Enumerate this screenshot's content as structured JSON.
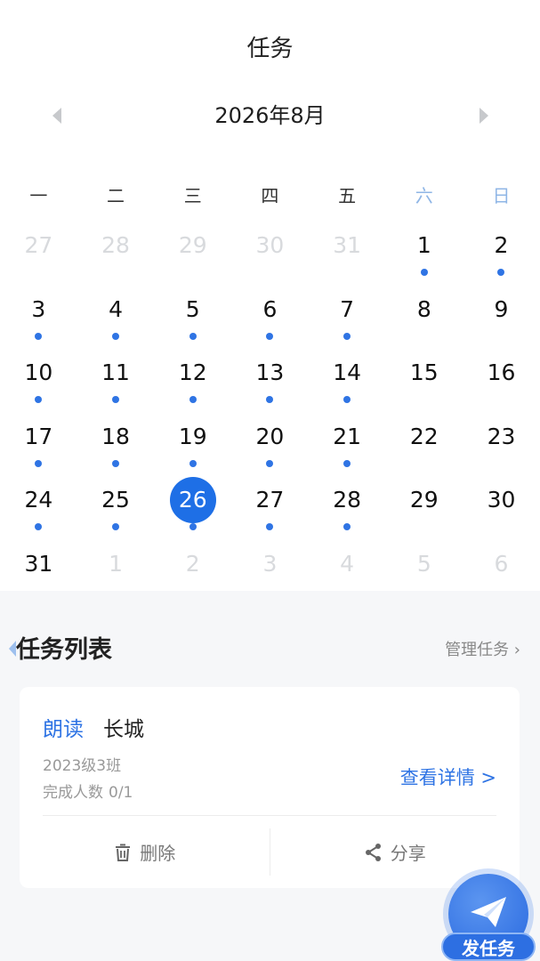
{
  "header": {
    "title": "任务"
  },
  "calendar": {
    "month_label": "2026年8月",
    "weekdays": [
      "一",
      "二",
      "三",
      "四",
      "五",
      "六",
      "日"
    ],
    "weekend_indices": [
      5,
      6
    ],
    "selected_day": 26,
    "days": [
      {
        "n": "27",
        "muted": true,
        "dot": false
      },
      {
        "n": "28",
        "muted": true,
        "dot": false
      },
      {
        "n": "29",
        "muted": true,
        "dot": false
      },
      {
        "n": "30",
        "muted": true,
        "dot": false
      },
      {
        "n": "31",
        "muted": true,
        "dot": false
      },
      {
        "n": "1",
        "muted": false,
        "dot": true
      },
      {
        "n": "2",
        "muted": false,
        "dot": true
      },
      {
        "n": "3",
        "muted": false,
        "dot": true
      },
      {
        "n": "4",
        "muted": false,
        "dot": true
      },
      {
        "n": "5",
        "muted": false,
        "dot": true
      },
      {
        "n": "6",
        "muted": false,
        "dot": true
      },
      {
        "n": "7",
        "muted": false,
        "dot": true
      },
      {
        "n": "8",
        "muted": false,
        "dot": false
      },
      {
        "n": "9",
        "muted": false,
        "dot": false
      },
      {
        "n": "10",
        "muted": false,
        "dot": true
      },
      {
        "n": "11",
        "muted": false,
        "dot": true
      },
      {
        "n": "12",
        "muted": false,
        "dot": true
      },
      {
        "n": "13",
        "muted": false,
        "dot": true
      },
      {
        "n": "14",
        "muted": false,
        "dot": true
      },
      {
        "n": "15",
        "muted": false,
        "dot": false
      },
      {
        "n": "16",
        "muted": false,
        "dot": false
      },
      {
        "n": "17",
        "muted": false,
        "dot": true
      },
      {
        "n": "18",
        "muted": false,
        "dot": true
      },
      {
        "n": "19",
        "muted": false,
        "dot": true
      },
      {
        "n": "20",
        "muted": false,
        "dot": true
      },
      {
        "n": "21",
        "muted": false,
        "dot": true
      },
      {
        "n": "22",
        "muted": false,
        "dot": false
      },
      {
        "n": "23",
        "muted": false,
        "dot": false
      },
      {
        "n": "24",
        "muted": false,
        "dot": true
      },
      {
        "n": "25",
        "muted": false,
        "dot": true
      },
      {
        "n": "26",
        "muted": false,
        "dot": true,
        "selected": true
      },
      {
        "n": "27",
        "muted": false,
        "dot": true
      },
      {
        "n": "28",
        "muted": false,
        "dot": true
      },
      {
        "n": "29",
        "muted": false,
        "dot": false
      },
      {
        "n": "30",
        "muted": false,
        "dot": false
      },
      {
        "n": "31",
        "muted": false,
        "dot": false
      },
      {
        "n": "1",
        "muted": true,
        "dot": false
      },
      {
        "n": "2",
        "muted": true,
        "dot": false
      },
      {
        "n": "3",
        "muted": true,
        "dot": false
      },
      {
        "n": "4",
        "muted": true,
        "dot": false
      },
      {
        "n": "5",
        "muted": true,
        "dot": false
      },
      {
        "n": "6",
        "muted": true,
        "dot": false
      }
    ]
  },
  "task_list": {
    "title": "任务列表",
    "manage_label": "管理任务 ›"
  },
  "task_card": {
    "type": "朗读",
    "name": "长城",
    "class_name": "2023级3班",
    "progress_label": "完成人数",
    "progress_value": "0/1",
    "detail_label": "查看详情 >",
    "delete_label": "删除",
    "share_label": "分享"
  },
  "fab": {
    "label": "发任务"
  },
  "icons": {
    "prev": "chevron-left-icon",
    "next": "chevron-right-icon",
    "delete": "trash-icon",
    "share": "share-icon",
    "fab": "paper-plane-icon"
  },
  "colors": {
    "accent": "#2f74e4",
    "selected_day": "#1e6fe6",
    "weekend": "#8fb6e6",
    "muted": "#d8dadd"
  }
}
